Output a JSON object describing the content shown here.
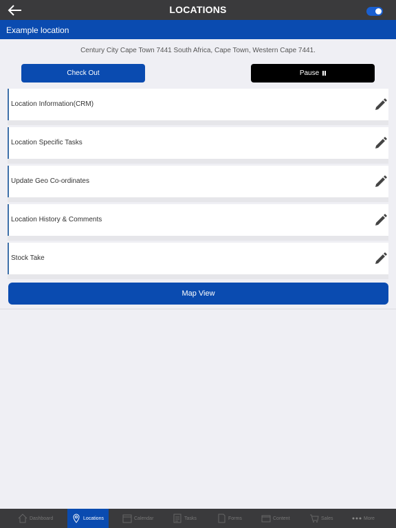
{
  "header": {
    "title": "LOCATIONS"
  },
  "location": {
    "name": "Example location",
    "address": "Century City Cape Town 7441 South Africa, Cape Town, Western Cape 7441."
  },
  "actions": {
    "check_out_label": "Check Out",
    "pause_label": "Pause"
  },
  "menu": {
    "items": [
      {
        "label": "Location Information(CRM)"
      },
      {
        "label": "Location Specific Tasks"
      },
      {
        "label": "Update Geo Co-ordinates"
      },
      {
        "label": "Location History & Comments"
      },
      {
        "label": "Stock Take"
      }
    ]
  },
  "map_view_label": "Map View",
  "tabbar": {
    "tabs": [
      {
        "label": "Dashboard",
        "icon": "home-icon"
      },
      {
        "label": "Locations",
        "icon": "location-pin-icon",
        "active": true
      },
      {
        "label": "Calendar",
        "icon": "calendar-icon"
      },
      {
        "label": "Tasks",
        "icon": "tasks-icon"
      },
      {
        "label": "Forms",
        "icon": "forms-icon"
      },
      {
        "label": "Content",
        "icon": "content-icon"
      },
      {
        "label": "Sales",
        "icon": "cart-icon"
      },
      {
        "label": "More",
        "icon": "more-icon"
      }
    ]
  },
  "colors": {
    "accent": "#0a4bb0",
    "topbar": "#3a3a3c",
    "background": "#efeff4"
  }
}
